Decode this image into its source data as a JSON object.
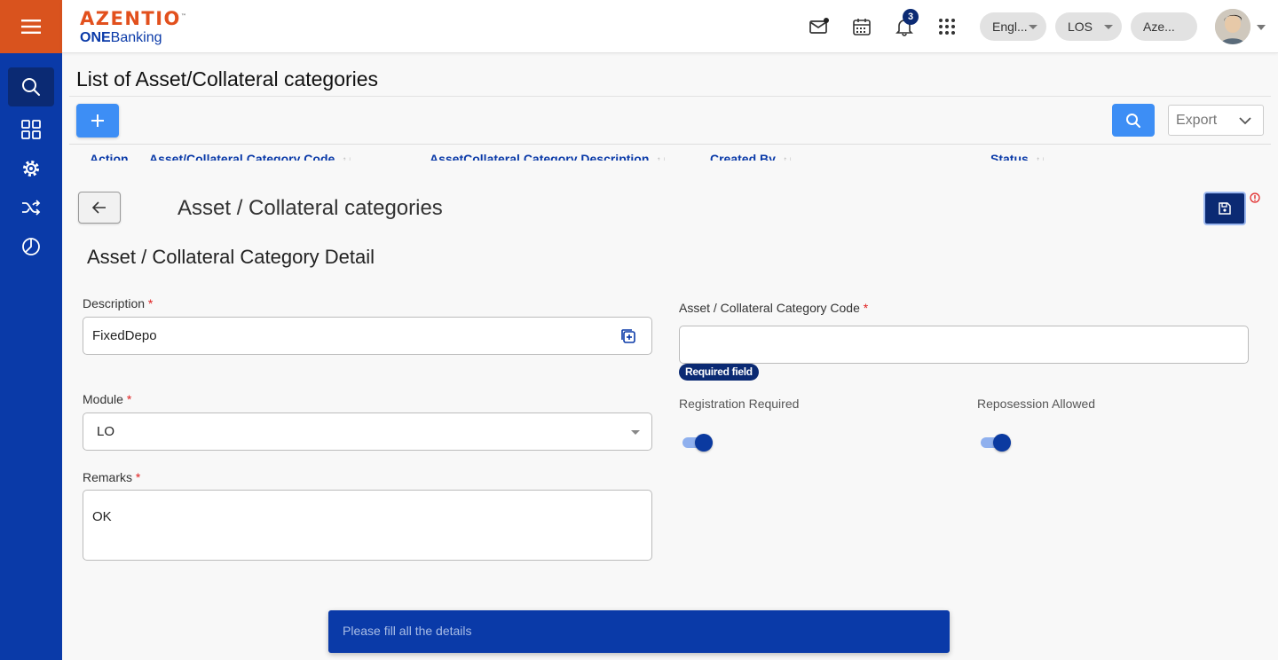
{
  "app": {
    "brand": "AZENTIO",
    "sub_bold": "ONE",
    "sub_rest": "Banking"
  },
  "header": {
    "notification_count": "3",
    "language": "Engl...",
    "module": "LOS",
    "entity": "Aze..."
  },
  "list_page": {
    "title": "List of Asset/Collateral categories",
    "export_label": "Export",
    "columns": [
      "Action",
      "Asset/Collateral Category Code",
      "AssetCollateral Category Description",
      "Created By",
      "Status"
    ]
  },
  "detail": {
    "title": "Asset / Collateral categories",
    "section_title": "Asset / Collateral Category Detail",
    "description": {
      "label": "Description",
      "value": "FixedDepo"
    },
    "code": {
      "label": "Asset / Collateral Category Code",
      "value": "",
      "error": "Required field"
    },
    "module": {
      "label": "Module",
      "value": "LO"
    },
    "remarks": {
      "label": "Remarks",
      "value": "OK"
    },
    "registration_required": {
      "label": "Registration Required",
      "checked": true
    },
    "reposession_allowed": {
      "label": "Reposession Allowed",
      "checked": true
    },
    "required_marker": "*"
  },
  "toast": {
    "message": "Please fill all the details"
  },
  "colors": {
    "brand_orange": "#e2501d",
    "sidebar_blue": "#0a3aa8",
    "primary_button": "#3d8ef5",
    "dark_navy": "#0b2a73"
  }
}
